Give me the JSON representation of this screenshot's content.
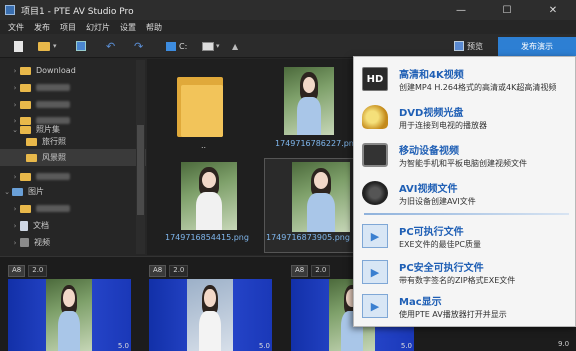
{
  "window": {
    "title": "项目1 - PTE AV Studio Pro",
    "minimize": "—",
    "maximize": "☐",
    "close": "✕"
  },
  "menu": [
    "文件",
    "发布",
    "项目",
    "幻灯片",
    "设置",
    "帮助"
  ],
  "toolbar": {
    "path_label": "C:",
    "preview_label": "预览",
    "publish_label": "发布演示"
  },
  "tree": [
    {
      "label": "Download",
      "icon": "folder-icon",
      "expanded": false
    },
    {
      "label": "",
      "icon": "folder-icon",
      "expanded": false
    },
    {
      "label": "",
      "icon": "folder-icon",
      "expanded": false
    },
    {
      "label": "",
      "icon": "folder-icon",
      "expanded": false
    },
    {
      "label": "照片集",
      "icon": "folder-icon",
      "expanded": true
    },
    {
      "label": "旅行照",
      "icon": "folder-icon",
      "expanded": false
    },
    {
      "label": "风景照",
      "icon": "folder-icon",
      "expanded": false,
      "selected": true
    },
    {
      "label": "",
      "icon": "folder-icon",
      "expanded": false
    },
    {
      "label": "图片",
      "icon": "pc-icon",
      "expanded": true
    },
    {
      "label": "",
      "icon": "folder-icon",
      "expanded": false
    },
    {
      "label": "文档",
      "icon": "document-icon",
      "expanded": false
    },
    {
      "label": "视频",
      "icon": "video-icon",
      "expanded": false
    }
  ],
  "files": {
    "folder_label": "..",
    "file1": "1749716786227.png",
    "file2": "1749716854415.png",
    "file3": "1749716873905.png"
  },
  "publish_menu": [
    {
      "title": "高清和4K视频",
      "subtitle": "创建MP4 H.264格式的高清或4K超高清视频",
      "icon": "hd-icon"
    },
    {
      "title": "DVD视频光盘",
      "subtitle": "用于连接到电视的播放器",
      "icon": "dvd-icon"
    },
    {
      "title": "移动设备视频",
      "subtitle": "为智能手机和平板电脑创建视频文件",
      "icon": "mobile-device-icon"
    },
    {
      "title": "AVI视频文件",
      "subtitle": "为旧设备创建AVI文件",
      "icon": "avi-film-icon"
    },
    {
      "title": "PC可执行文件",
      "subtitle": "EXE文件的最佳PC质量",
      "icon": "pc-exe-icon"
    },
    {
      "title": "PC安全可执行文件",
      "subtitle": "带有数字签名的ZIP格式EXE文件",
      "icon": "pc-safe-exe-icon"
    },
    {
      "title": "Mac显示",
      "subtitle": "使用PTE AV播放器打开并显示",
      "icon": "mac-show-icon"
    }
  ],
  "slides": [
    {
      "badge": "A8",
      "number": "2.0",
      "duration": "5.0"
    },
    {
      "badge": "A8",
      "number": "2.0",
      "duration": "5.0"
    },
    {
      "badge": "A8",
      "number": "2.0",
      "duration": "5.0"
    }
  ],
  "strip_extra_duration": "9.0"
}
